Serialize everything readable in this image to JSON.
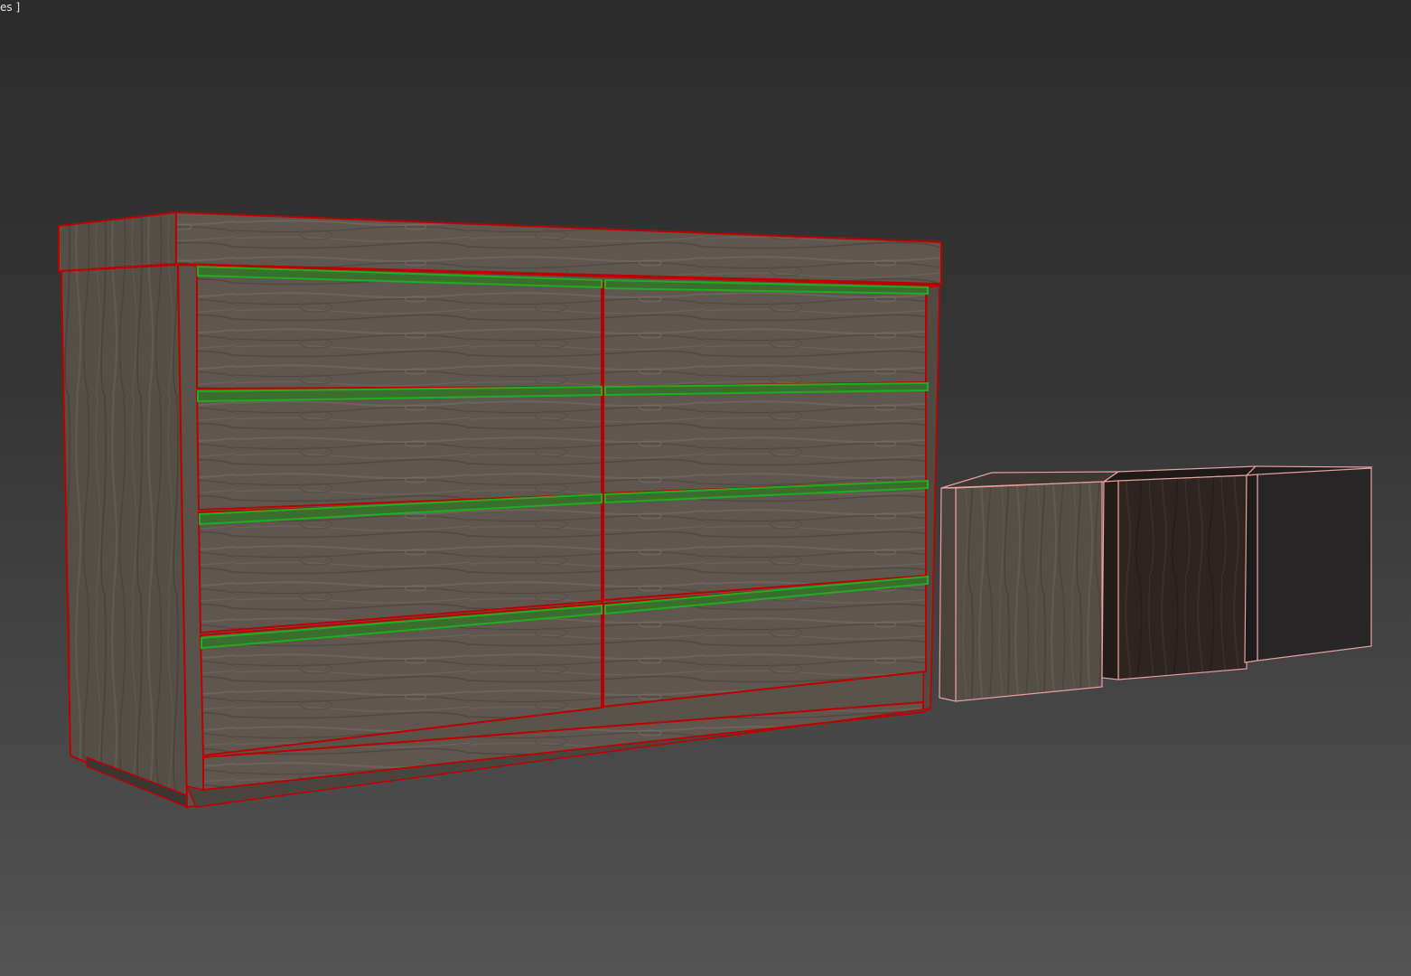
{
  "viewport": {
    "label": "es ]",
    "background_top": "#2b2b2b",
    "background_bottom": "#545454"
  },
  "colors": {
    "wood_mid": "#5f574f",
    "wood_light": "#6e665c",
    "wood_dark": "#4a433d",
    "edge_selected": "#c00000",
    "edge_handle": "#1fae1f",
    "edge_sample": "#e8a0a0",
    "sample_dark_wood": "#2e2420",
    "sample_black": "#262424"
  },
  "scene": {
    "objects": [
      {
        "name": "dresser",
        "type": "8-drawer-dresser",
        "material": "wood_mid",
        "wireframe": "edge_selected"
      },
      {
        "name": "drawer-handles",
        "count": 8,
        "wireframe": "edge_handle"
      },
      {
        "name": "material-sample-light-wood",
        "material": "wood_mid",
        "wireframe": "edge_sample"
      },
      {
        "name": "material-sample-dark-wood",
        "material": "sample_dark_wood",
        "wireframe": "edge_sample"
      },
      {
        "name": "material-sample-black",
        "material": "sample_black",
        "wireframe": "edge_sample"
      }
    ]
  }
}
